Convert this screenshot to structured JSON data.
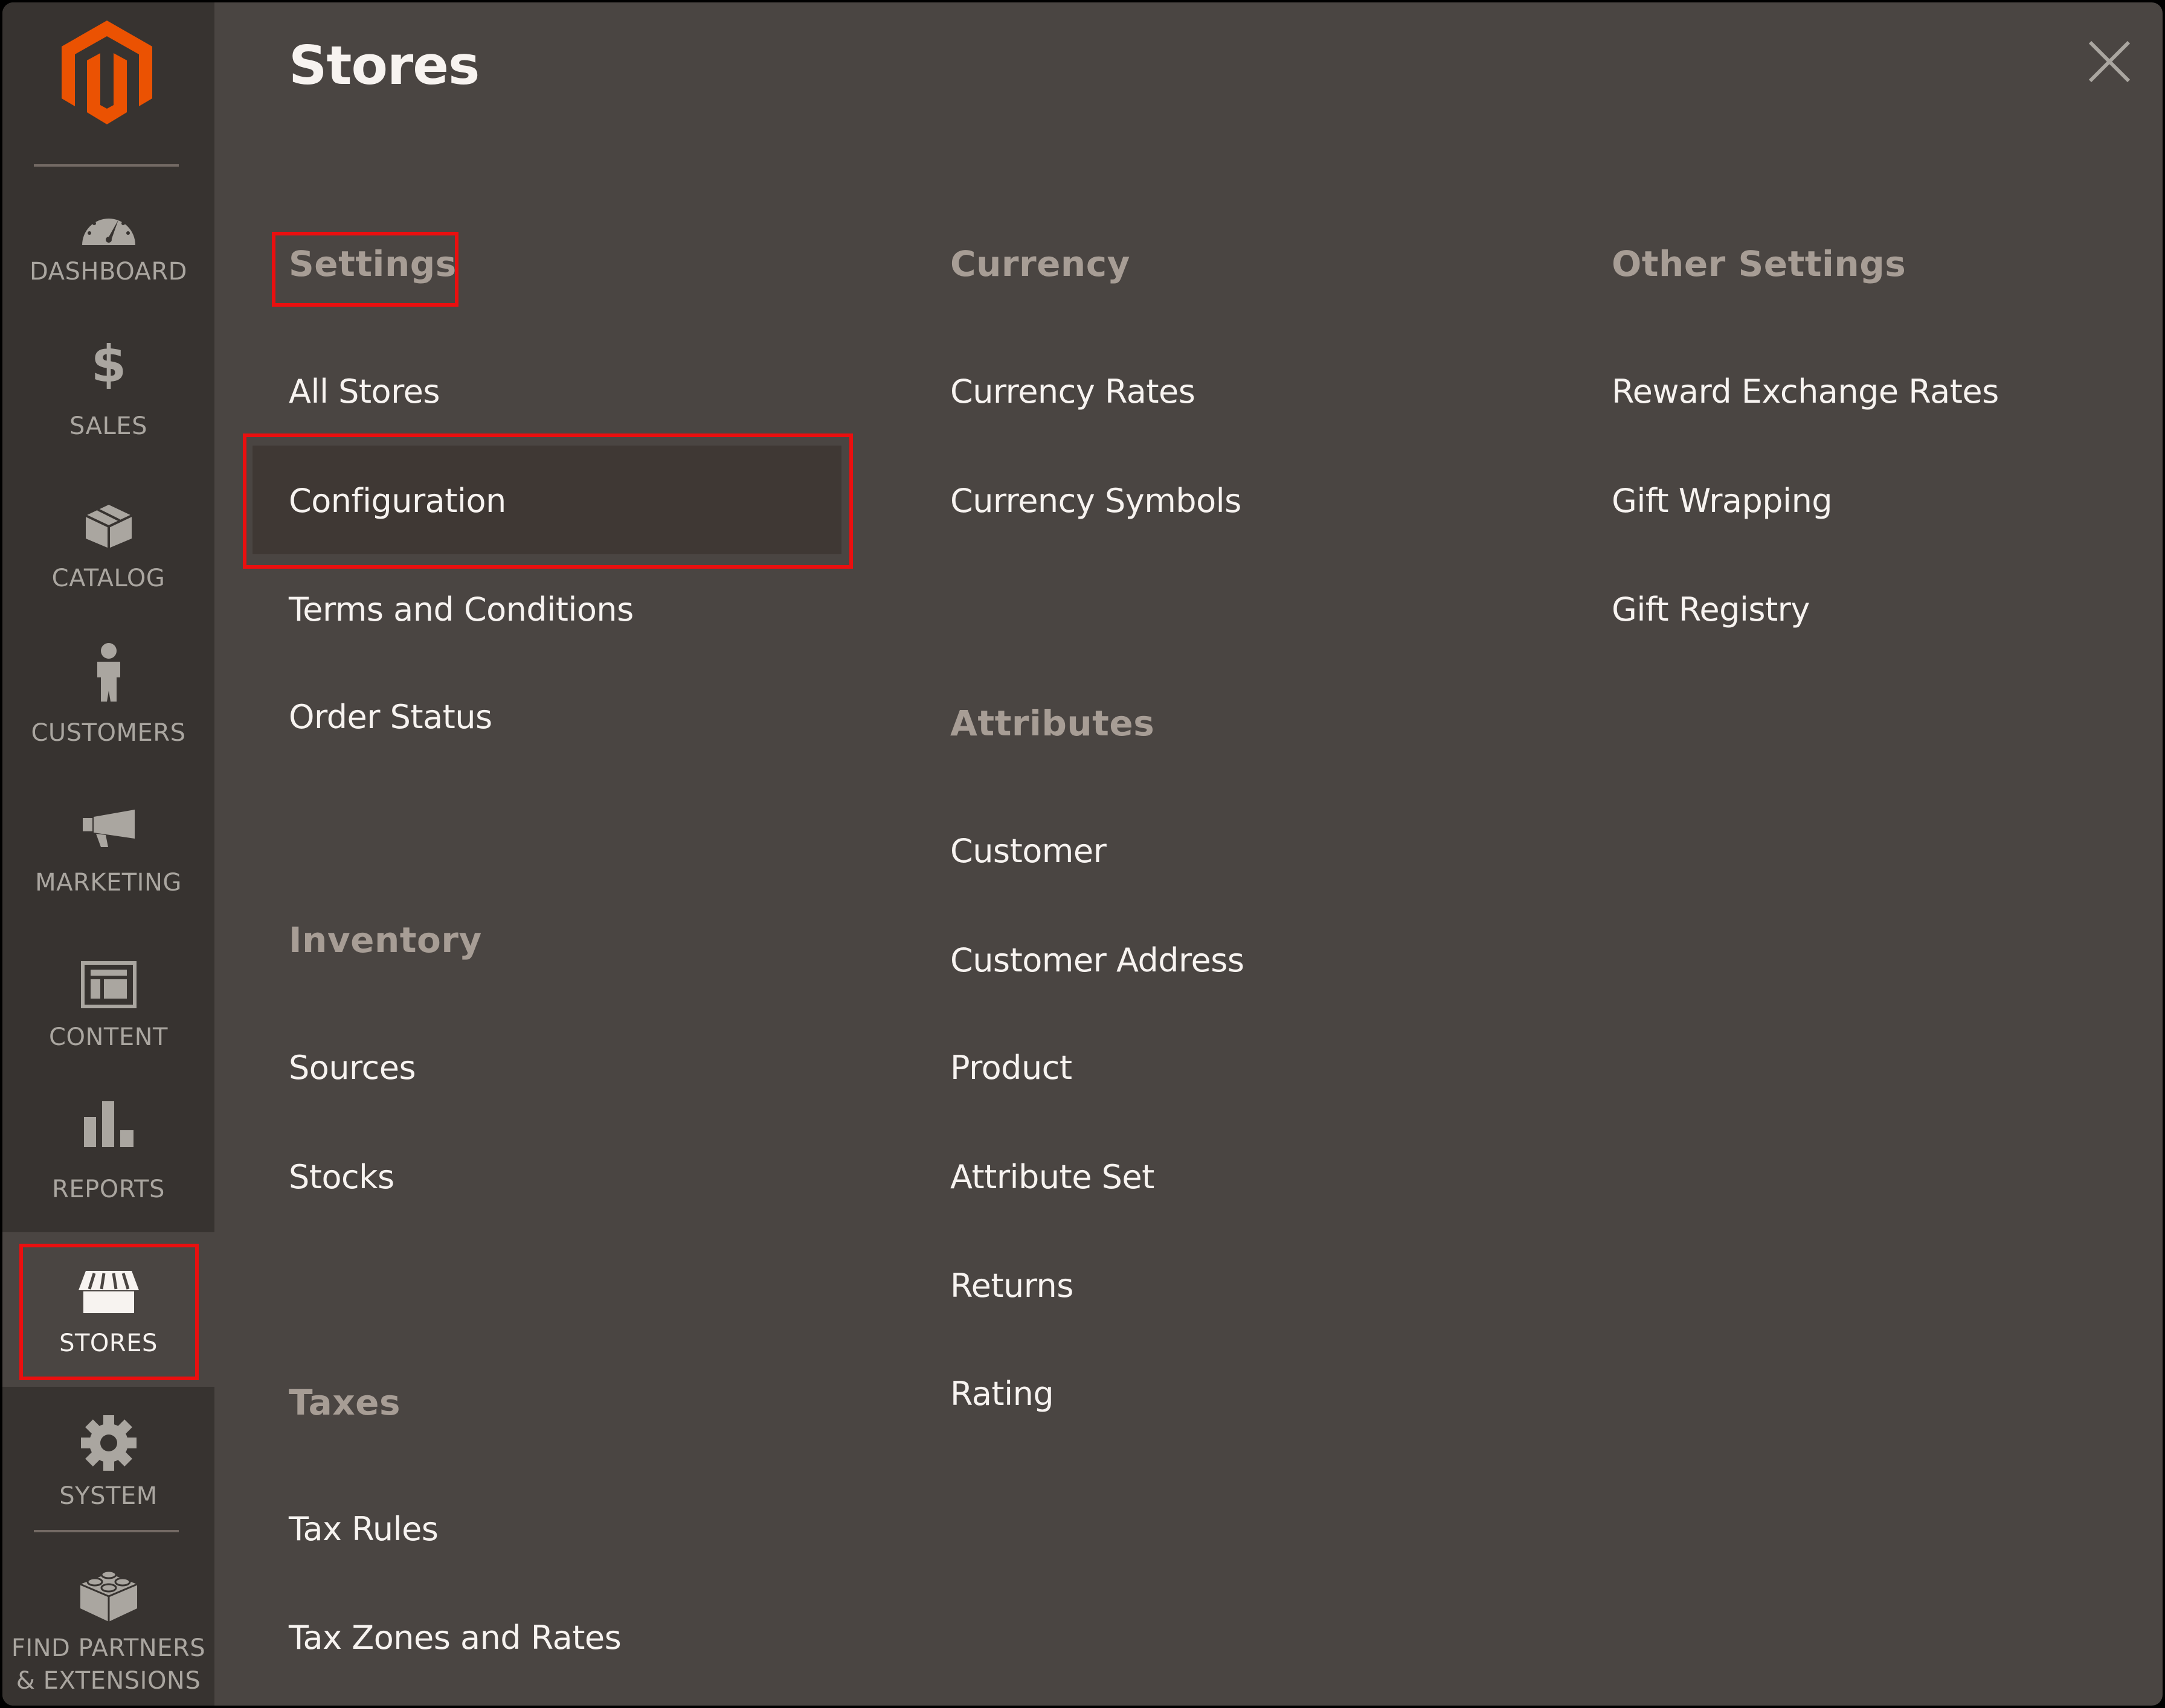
{
  "sidebar": {
    "items": [
      {
        "label": "DASHBOARD",
        "icon": "dashboard-gauge-icon"
      },
      {
        "label": "SALES",
        "icon": "dollar-icon"
      },
      {
        "label": "CATALOG",
        "icon": "box-icon"
      },
      {
        "label": "CUSTOMERS",
        "icon": "person-icon"
      },
      {
        "label": "MARKETING",
        "icon": "megaphone-icon"
      },
      {
        "label": "CONTENT",
        "icon": "layout-icon"
      },
      {
        "label": "REPORTS",
        "icon": "bar-chart-icon"
      },
      {
        "label": "STORES",
        "icon": "storefront-icon",
        "active": true
      },
      {
        "label": "SYSTEM",
        "icon": "gear-icon"
      },
      {
        "label_line1": "FIND PARTNERS",
        "label_line2": "& EXTENSIONS",
        "icon": "lego-brick-icon"
      }
    ]
  },
  "panel": {
    "title": "Stores",
    "close_icon": "close-icon",
    "columns": [
      {
        "groups": [
          {
            "header": "Settings",
            "items": [
              "All Stores",
              "Configuration",
              "Terms and Conditions",
              "Order Status"
            ]
          },
          {
            "header": "Inventory",
            "items": [
              "Sources",
              "Stocks"
            ]
          },
          {
            "header": "Taxes",
            "items": [
              "Tax Rules",
              "Tax Zones and Rates"
            ]
          }
        ]
      },
      {
        "groups": [
          {
            "header": "Currency",
            "items": [
              "Currency Rates",
              "Currency Symbols"
            ]
          },
          {
            "header": "Attributes",
            "items": [
              "Customer",
              "Customer Address",
              "Product",
              "Attribute Set",
              "Returns",
              "Rating"
            ]
          }
        ]
      },
      {
        "groups": [
          {
            "header": "Other Settings",
            "items": [
              "Reward Exchange Rates",
              "Gift Wrapping",
              "Gift Registry"
            ]
          }
        ]
      }
    ],
    "highlighted_item": "Configuration"
  },
  "colors": {
    "brand_orange": "#eb5202",
    "annotation_red": "#ea0f0f",
    "sidebar_bg": "#373330",
    "panel_bg": "#4a4542"
  }
}
